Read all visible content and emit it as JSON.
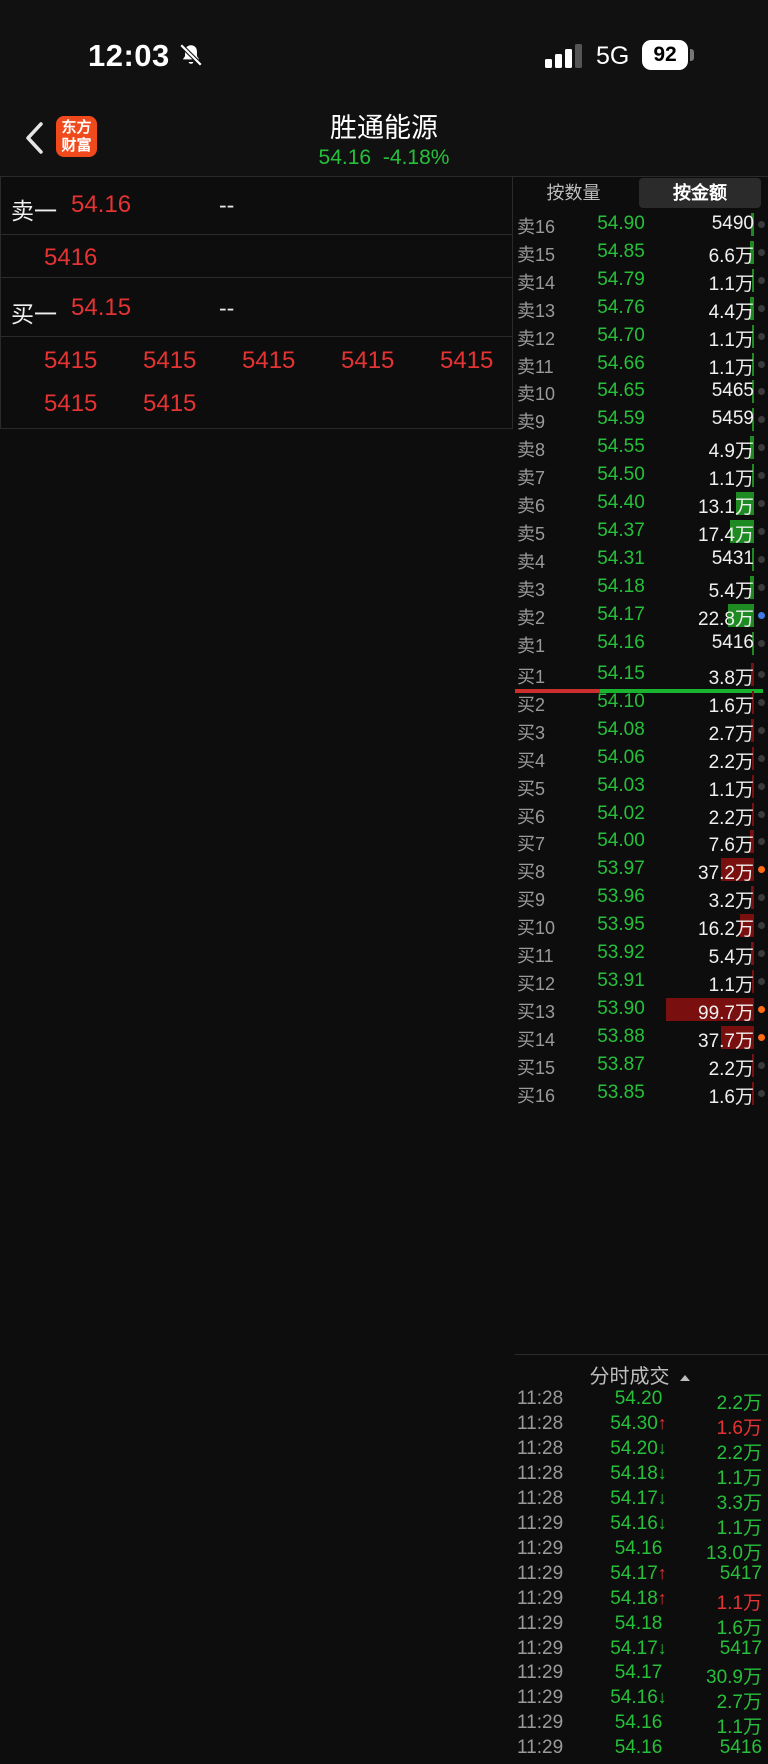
{
  "status_bar": {
    "time": "12:03",
    "network": "5G",
    "battery": "92"
  },
  "header": {
    "logo_line1": "东方",
    "logo_line2": "财富",
    "stock_name": "胜通能源",
    "price": "54.16",
    "change_pct": "-4.18%"
  },
  "level1": {
    "sell_label": "卖一",
    "sell_price": "54.16",
    "sell_dash": "--",
    "sell_queue": "5416",
    "buy_label": "买一",
    "buy_price": "54.15",
    "buy_dash": "--",
    "buy_queue": [
      "5415",
      "5415",
      "5415",
      "5415",
      "5415",
      "5415",
      "5415"
    ]
  },
  "orderbook": {
    "tabs": [
      "按数量",
      "按金额"
    ],
    "active_tab": "按金额",
    "asks": [
      {
        "label": "卖16",
        "price": "54.90",
        "amount": "5490",
        "bar_fraction": 0.03,
        "dot": "none"
      },
      {
        "label": "卖15",
        "price": "54.85",
        "amount": "6.6万",
        "bar_fraction": 0.05,
        "dot": "none"
      },
      {
        "label": "卖14",
        "price": "54.79",
        "amount": "1.1万",
        "bar_fraction": 0.02,
        "dot": "none"
      },
      {
        "label": "卖13",
        "price": "54.76",
        "amount": "4.4万",
        "bar_fraction": 0.04,
        "dot": "none"
      },
      {
        "label": "卖12",
        "price": "54.70",
        "amount": "1.1万",
        "bar_fraction": 0.02,
        "dot": "none"
      },
      {
        "label": "卖11",
        "price": "54.66",
        "amount": "1.1万",
        "bar_fraction": 0.02,
        "dot": "none"
      },
      {
        "label": "卖10",
        "price": "54.65",
        "amount": "5465",
        "bar_fraction": 0.0,
        "dot": "none"
      },
      {
        "label": "卖9",
        "price": "54.59",
        "amount": "5459",
        "bar_fraction": 0.0,
        "dot": "none"
      },
      {
        "label": "卖8",
        "price": "54.55",
        "amount": "4.9万",
        "bar_fraction": 0.04,
        "dot": "none"
      },
      {
        "label": "卖7",
        "price": "54.50",
        "amount": "1.1万",
        "bar_fraction": 0.02,
        "dot": "none"
      },
      {
        "label": "卖6",
        "price": "54.40",
        "amount": "13.1万",
        "bar_fraction": 0.2,
        "dot": "none"
      },
      {
        "label": "卖5",
        "price": "54.37",
        "amount": "17.4万",
        "bar_fraction": 0.27,
        "dot": "none"
      },
      {
        "label": "卖4",
        "price": "54.31",
        "amount": "5431",
        "bar_fraction": 0.0,
        "dot": "none"
      },
      {
        "label": "卖3",
        "price": "54.18",
        "amount": "5.4万",
        "bar_fraction": 0.04,
        "dot": "none"
      },
      {
        "label": "卖2",
        "price": "54.17",
        "amount": "22.8万",
        "bar_fraction": 0.3,
        "dot": "blue"
      },
      {
        "label": "卖1",
        "price": "54.16",
        "amount": "5416",
        "bar_fraction": 0.0,
        "dot": "none"
      }
    ],
    "bids": [
      {
        "label": "买1",
        "price": "54.15",
        "amount": "3.8万",
        "bar_fraction": 0.03,
        "dot": "none"
      },
      {
        "label": "买2",
        "price": "54.10",
        "amount": "1.6万",
        "bar_fraction": 0.02,
        "dot": "none"
      },
      {
        "label": "买3",
        "price": "54.08",
        "amount": "2.7万",
        "bar_fraction": 0.03,
        "dot": "none"
      },
      {
        "label": "买4",
        "price": "54.06",
        "amount": "2.2万",
        "bar_fraction": 0.02,
        "dot": "none"
      },
      {
        "label": "买5",
        "price": "54.03",
        "amount": "1.1万",
        "bar_fraction": 0.01,
        "dot": "none"
      },
      {
        "label": "买6",
        "price": "54.02",
        "amount": "2.2万",
        "bar_fraction": 0.02,
        "dot": "none"
      },
      {
        "label": "买7",
        "price": "54.00",
        "amount": "7.6万",
        "bar_fraction": 0.05,
        "dot": "none"
      },
      {
        "label": "买8",
        "price": "53.97",
        "amount": "37.2万",
        "bar_fraction": 0.37,
        "dot": "orange"
      },
      {
        "label": "买9",
        "price": "53.96",
        "amount": "3.2万",
        "bar_fraction": 0.03,
        "dot": "none"
      },
      {
        "label": "买10",
        "price": "53.95",
        "amount": "16.2万",
        "bar_fraction": 0.16,
        "dot": "none"
      },
      {
        "label": "买11",
        "price": "53.92",
        "amount": "5.4万",
        "bar_fraction": 0.03,
        "dot": "none"
      },
      {
        "label": "买12",
        "price": "53.91",
        "amount": "1.1万",
        "bar_fraction": 0.01,
        "dot": "none"
      },
      {
        "label": "买13",
        "price": "53.90",
        "amount": "99.7万",
        "bar_fraction": 1.0,
        "dot": "orange"
      },
      {
        "label": "买14",
        "price": "53.88",
        "amount": "37.7万",
        "bar_fraction": 0.37,
        "dot": "orange"
      },
      {
        "label": "买15",
        "price": "53.87",
        "amount": "2.2万",
        "bar_fraction": 0.02,
        "dot": "none"
      },
      {
        "label": "买16",
        "price": "53.85",
        "amount": "1.6万",
        "bar_fraction": 0.02,
        "dot": "none"
      }
    ]
  },
  "trades": {
    "title": "分时成交",
    "rows": [
      {
        "time": "11:28",
        "price": "54.20",
        "arrow": "",
        "volume": "2.2万",
        "volume_color": "green"
      },
      {
        "time": "11:28",
        "price": "54.30",
        "arrow": "↑",
        "volume": "1.6万",
        "volume_color": "red"
      },
      {
        "time": "11:28",
        "price": "54.20",
        "arrow": "↓",
        "volume": "2.2万",
        "volume_color": "green"
      },
      {
        "time": "11:28",
        "price": "54.18",
        "arrow": "↓",
        "volume": "1.1万",
        "volume_color": "green"
      },
      {
        "time": "11:28",
        "price": "54.17",
        "arrow": "↓",
        "volume": "3.3万",
        "volume_color": "green"
      },
      {
        "time": "11:29",
        "price": "54.16",
        "arrow": "↓",
        "volume": "1.1万",
        "volume_color": "green"
      },
      {
        "time": "11:29",
        "price": "54.16",
        "arrow": "",
        "volume": "13.0万",
        "volume_color": "green"
      },
      {
        "time": "11:29",
        "price": "54.17",
        "arrow": "↑",
        "volume": "5417",
        "volume_color": "green"
      },
      {
        "time": "11:29",
        "price": "54.18",
        "arrow": "↑",
        "volume": "1.1万",
        "volume_color": "red"
      },
      {
        "time": "11:29",
        "price": "54.18",
        "arrow": "",
        "volume": "1.6万",
        "volume_color": "green"
      },
      {
        "time": "11:29",
        "price": "54.17",
        "arrow": "↓",
        "volume": "5417",
        "volume_color": "green"
      },
      {
        "time": "11:29",
        "price": "54.17",
        "arrow": "",
        "volume": "30.9万",
        "volume_color": "green"
      },
      {
        "time": "11:29",
        "price": "54.16",
        "arrow": "↓",
        "volume": "2.7万",
        "volume_color": "green"
      },
      {
        "time": "11:29",
        "price": "54.16",
        "arrow": "",
        "volume": "1.1万",
        "volume_color": "green"
      },
      {
        "time": "11:29",
        "price": "54.16",
        "arrow": "",
        "volume": "5416",
        "volume_color": "green"
      }
    ]
  },
  "colors": {
    "up": "#e53333",
    "down": "#26c03a",
    "brand": "#f04a1c"
  }
}
